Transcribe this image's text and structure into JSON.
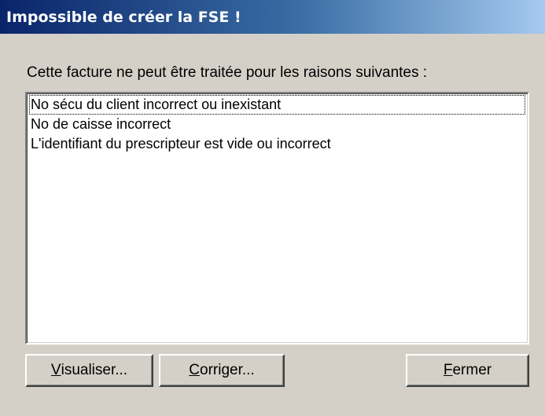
{
  "window": {
    "title": "Impossible de créer la FSE !"
  },
  "message": "Cette facture ne peut être traitée pour les raisons suivantes :",
  "reasons": [
    "No sécu du client incorrect ou inexistant",
    "No de caisse incorrect",
    "L'identifiant du prescripteur est vide ou incorrect"
  ],
  "buttons": {
    "visualiser": {
      "mnemonic": "V",
      "rest": "isualiser..."
    },
    "corriger": {
      "mnemonic": "C",
      "rest": "orriger..."
    },
    "fermer": {
      "mnemonic": "F",
      "rest": "ermer"
    }
  },
  "colors": {
    "title_bar_start": "#0a246a",
    "title_bar_end": "#a6caf0",
    "dialog_background": "#d4d0c8",
    "list_background": "#ffffff"
  }
}
